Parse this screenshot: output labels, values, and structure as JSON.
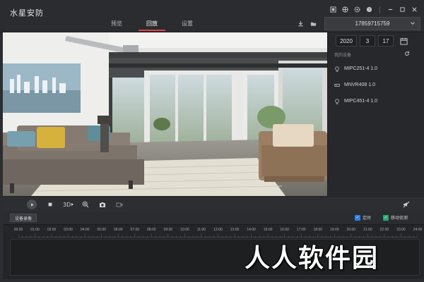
{
  "app": {
    "title": "水星安防"
  },
  "nav": {
    "tabs": [
      {
        "label": "预览"
      },
      {
        "label": "回放"
      },
      {
        "label": "设置"
      }
    ],
    "active": 1
  },
  "window_icons": [
    "qr-icon",
    "grid-icon",
    "gear-icon",
    "help-icon",
    "minimize-icon",
    "maximize-icon",
    "close-icon"
  ],
  "device_selector": {
    "value": "17859715759"
  },
  "date": {
    "year": "2020",
    "month": "3",
    "day": "17"
  },
  "devices": {
    "header": "我的设备",
    "items": [
      {
        "name": "MIPC251-4 1.0",
        "icon": "camera-icon"
      },
      {
        "name": "MNVR408 1.0",
        "icon": "nvr-icon"
      },
      {
        "name": "MIPC451-4 1.0",
        "icon": "camera-icon"
      }
    ]
  },
  "record_bar": {
    "device_record_label": "设备录像",
    "timed_label": "定时",
    "motion_label": "移动侦测",
    "timed_checked": true,
    "motion_checked": true
  },
  "timeline": {
    "ticks": [
      "00:00",
      "01:00",
      "02:00",
      "03:00",
      "04:00",
      "05:00",
      "06:00",
      "07:00",
      "08:00",
      "09:00",
      "10:00",
      "11:00",
      "12:00",
      "13:00",
      "14:00",
      "15:00",
      "16:00",
      "17:00",
      "18:00",
      "19:00",
      "20:00",
      "21:00",
      "22:00",
      "23:00",
      "24:00"
    ]
  },
  "watermark": {
    "text": "人人软件园"
  },
  "colors": {
    "accent": "#e0404a",
    "timed_check": "#2f7ee6",
    "motion_check": "#2aa876"
  }
}
